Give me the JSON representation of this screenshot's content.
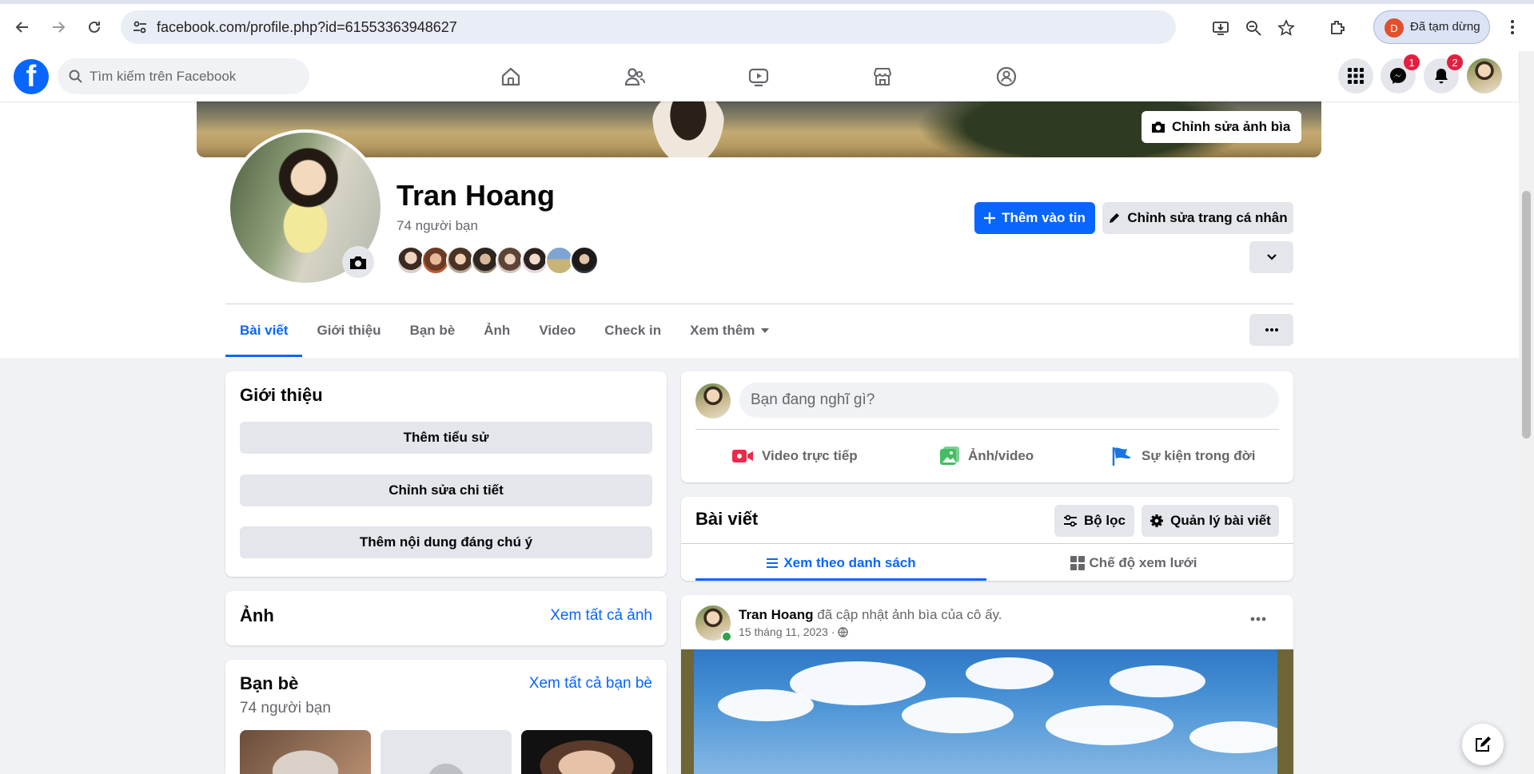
{
  "browser": {
    "url": "facebook.com/profile.php?id=61553363948627",
    "profile_initial": "D",
    "profile_status": "Đã tạm dừng"
  },
  "header": {
    "search_placeholder": "Tìm kiếm trên Facebook",
    "messenger_badge": "1",
    "notifications_badge": "2"
  },
  "profile": {
    "edit_cover_label": "Chỉnh sửa ảnh bìa",
    "name": "Tran Hoang",
    "friends_count": "74 người bạn",
    "add_story_label": "Thêm vào tin",
    "edit_profile_label": "Chỉnh sửa trang cá nhân"
  },
  "tabs": [
    {
      "label": "Bài viết",
      "active": true
    },
    {
      "label": "Giới thiệu"
    },
    {
      "label": "Bạn bè"
    },
    {
      "label": "Ảnh"
    },
    {
      "label": "Video"
    },
    {
      "label": "Check in"
    },
    {
      "label": "Xem thêm"
    }
  ],
  "intro": {
    "title": "Giới thiệu",
    "add_bio": "Thêm tiểu sử",
    "edit_details": "Chỉnh sửa chi tiết",
    "add_featured": "Thêm nội dung đáng chú ý"
  },
  "photos": {
    "title": "Ảnh",
    "see_all": "Xem tất cả ảnh"
  },
  "friends": {
    "title": "Bạn bè",
    "count": "74 người bạn",
    "see_all": "Xem tất cả bạn bè"
  },
  "composer": {
    "placeholder": "Bạn đang nghĩ gì?",
    "live_video": "Video trực tiếp",
    "photo_video": "Ảnh/video",
    "life_event": "Sự kiện trong đời"
  },
  "posts": {
    "title": "Bài viết",
    "filter": "Bộ lọc",
    "manage": "Quản lý bài viết",
    "list_view": "Xem theo danh sách",
    "grid_view": "Chế độ xem lưới"
  },
  "post": {
    "author": "Tran Hoang",
    "action": "đã cập nhật ảnh bìa của cô ấy.",
    "date": "15 tháng 11, 2023 ·"
  },
  "colors": {
    "brand": "#0866ff",
    "badge": "#e41e3f",
    "background": "#f0f2f5"
  }
}
